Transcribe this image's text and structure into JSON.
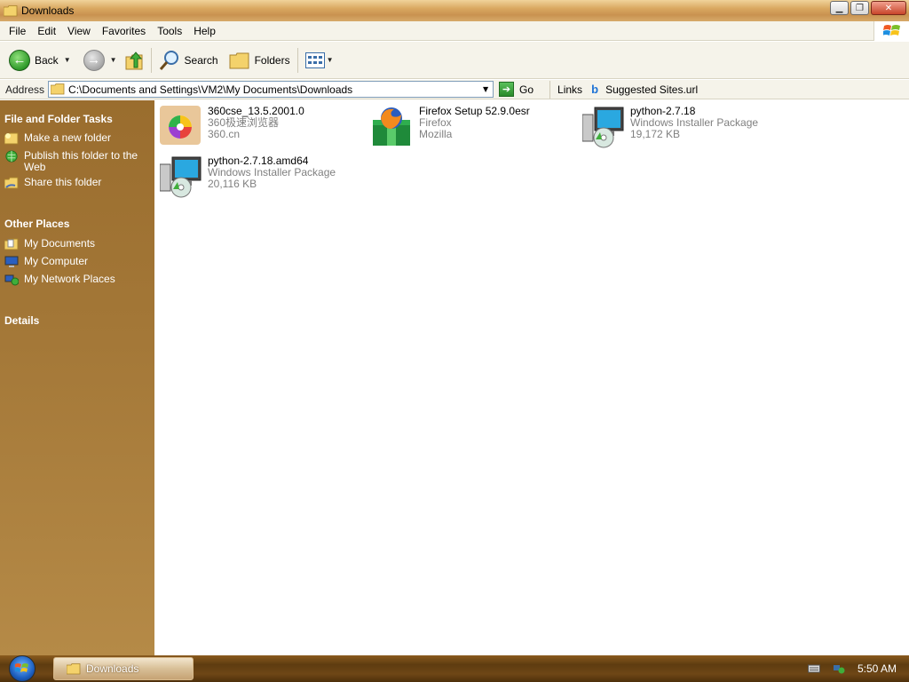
{
  "window": {
    "title": "Downloads"
  },
  "menu": [
    "File",
    "Edit",
    "View",
    "Favorites",
    "Tools",
    "Help"
  ],
  "toolbar": {
    "back": "Back",
    "search": "Search",
    "folders": "Folders"
  },
  "address": {
    "label": "Address",
    "path": "C:\\Documents and Settings\\VM2\\My Documents\\Downloads",
    "go": "Go",
    "links": "Links",
    "link_item": "Suggested Sites.url"
  },
  "sidebar": {
    "tasks_title": "File and Folder Tasks",
    "tasks": [
      "Make a new folder",
      "Publish this folder to the Web",
      "Share this folder"
    ],
    "places_title": "Other Places",
    "places": [
      "My Documents",
      "My Computer",
      "My Network Places"
    ],
    "details_title": "Details"
  },
  "files": [
    {
      "name": "360cse_13.5.2001.0",
      "line2": "360极速浏览器",
      "line3": "360.cn",
      "icon": "360-browser-icon"
    },
    {
      "name": "Firefox Setup 52.9.0esr",
      "line2": "Firefox",
      "line3": "Mozilla",
      "icon": "firefox-icon"
    },
    {
      "name": "python-2.7.18",
      "line2": "Windows Installer Package",
      "line3": "19,172 KB",
      "icon": "installer-icon"
    },
    {
      "name": "python-2.7.18.amd64",
      "line2": "Windows Installer Package",
      "line3": "20,116 KB",
      "icon": "installer-icon"
    }
  ],
  "taskbar": {
    "task": "Downloads",
    "clock": "5:50 AM"
  }
}
